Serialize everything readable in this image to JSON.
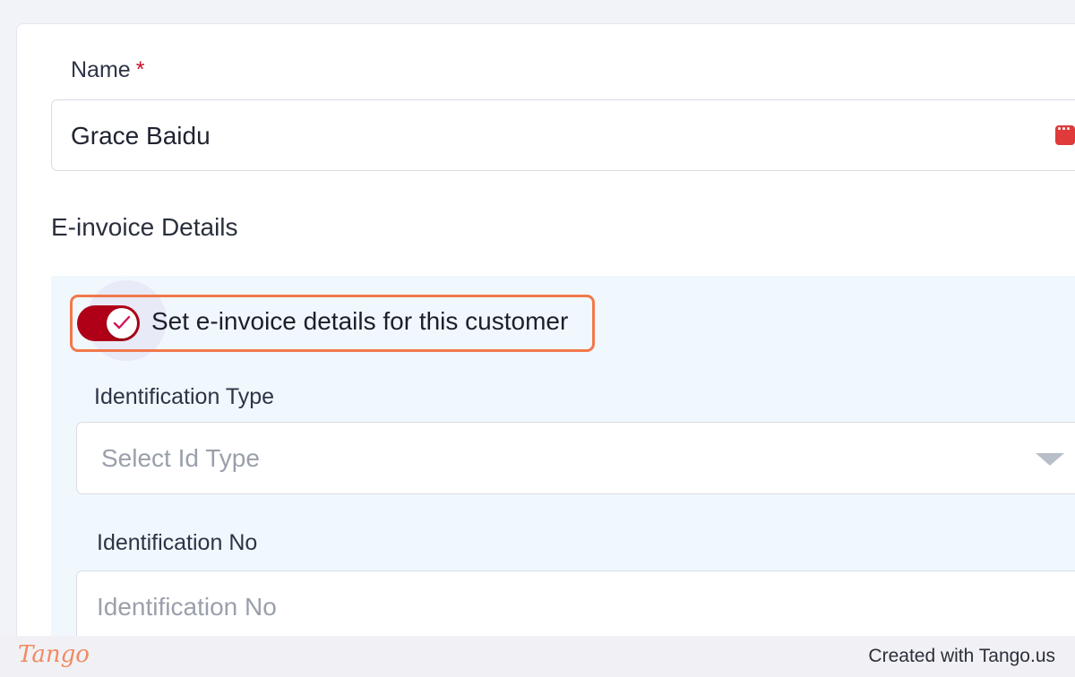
{
  "form": {
    "name_label": "Name",
    "name_required_marker": "*",
    "name_value": "Grace Baidu",
    "section_title": "E-invoice Details",
    "einvoice_toggle": {
      "label": "Set e-invoice details for this customer",
      "checked": true
    },
    "identification_type": {
      "label": "Identification Type",
      "placeholder": "Select Id Type"
    },
    "identification_no": {
      "label": "Identification No",
      "placeholder": "Identification No"
    }
  },
  "footer": {
    "logo": "Tango",
    "credit": "Created with Tango.us"
  },
  "colors": {
    "toggle_on": "#b00018",
    "required": "#c8102e",
    "highlight": "#f2784b",
    "panel_bg": "#f0f8fd"
  },
  "icons": [
    "keyboard-icon",
    "check-icon",
    "dropdown-caret-icon"
  ]
}
